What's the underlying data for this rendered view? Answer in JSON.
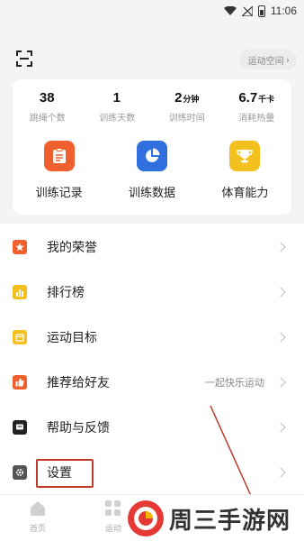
{
  "status_bar": {
    "time": "11:06"
  },
  "header": {
    "space_button": "运动空间"
  },
  "stats": [
    {
      "value": "38",
      "unit": "",
      "label": "跳绳个数"
    },
    {
      "value": "1",
      "unit": "",
      "label": "训练天数"
    },
    {
      "value": "2",
      "unit": "分钟",
      "label": "训练时间"
    },
    {
      "value": "6.7",
      "unit": "千卡",
      "label": "消耗热量"
    }
  ],
  "quick_actions": [
    {
      "label": "训练记录",
      "color": "#f0602e",
      "icon": "clipboard-icon"
    },
    {
      "label": "训练数据",
      "color": "#2f6fde",
      "icon": "pie-chart-icon"
    },
    {
      "label": "体育能力",
      "color": "#f3c01d",
      "icon": "trophy-icon"
    }
  ],
  "menu": [
    {
      "label": "我的荣誉",
      "extra": "",
      "color": "#f0602e",
      "icon": "star-badge-icon"
    },
    {
      "label": "排行榜",
      "extra": "",
      "color": "#f3c01d",
      "icon": "bar-chart-icon"
    },
    {
      "label": "运动目标",
      "extra": "",
      "color": "#f3c01d",
      "icon": "calendar-target-icon"
    },
    {
      "label": "推荐给好友",
      "extra": "一起快乐运动",
      "color": "#f0602e",
      "icon": "thumbs-up-icon"
    },
    {
      "label": "帮助与反馈",
      "extra": "",
      "color": "#222222",
      "icon": "chat-icon"
    },
    {
      "label": "设置",
      "extra": "",
      "color": "#555555",
      "icon": "gear-icon"
    }
  ],
  "tabbar": [
    {
      "label": "首页",
      "icon": "home-icon"
    },
    {
      "label": "运动",
      "icon": "grid-icon"
    }
  ],
  "watermark": {
    "text": "周三手游网"
  }
}
